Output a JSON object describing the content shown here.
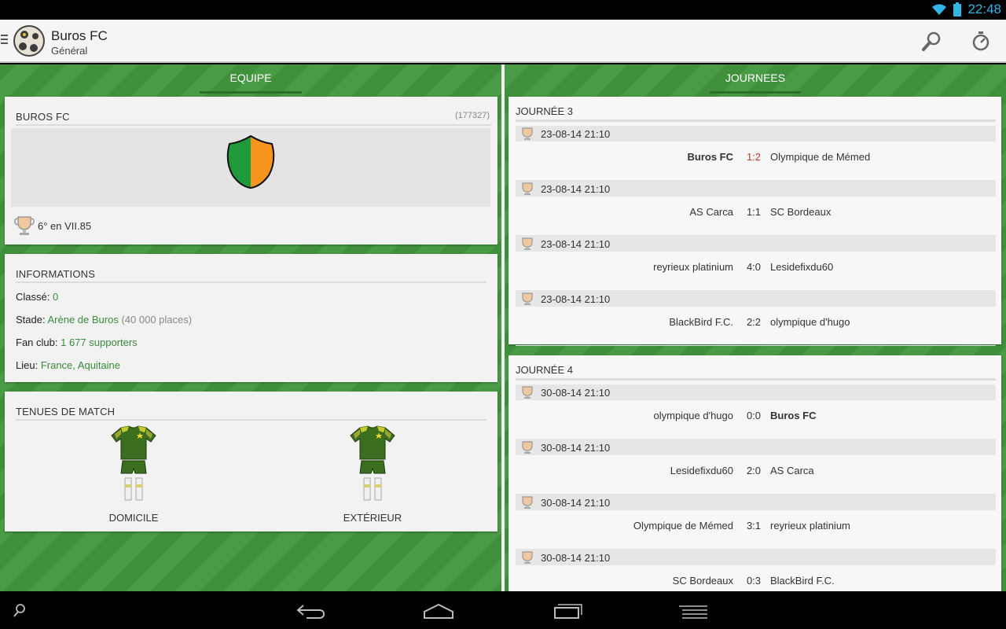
{
  "status_bar": {
    "time": "22:48"
  },
  "app_bar": {
    "title": "Buros FC",
    "subtitle": "Général"
  },
  "left_pane": {
    "header": "EQUIPE",
    "team_card": {
      "name": "BUROS FC",
      "id": "(177327)",
      "rank": "6° en VII.85",
      "crest_colors": [
        "#1f9a3a",
        "#f7941d"
      ]
    },
    "info_card": {
      "title": "INFORMATIONS",
      "rows": [
        {
          "label": "Classé:",
          "value": "0",
          "extra": ""
        },
        {
          "label": "Stade:",
          "value": "Arène de Buros",
          "extra": "(40 000 places)"
        },
        {
          "label": "Fan club:",
          "value": "1 677 supporters",
          "extra": ""
        },
        {
          "label": "Lieu:",
          "value": "France, Aquitaine",
          "extra": ""
        }
      ]
    },
    "kits_card": {
      "title": "TENUES DE MATCH",
      "home_label": "DOMICILE",
      "away_label": "EXTÉRIEUR"
    }
  },
  "right_pane": {
    "header": "JOURNEES",
    "journees": [
      {
        "title": "JOURNÉE 3",
        "matches": [
          {
            "date": "23-08-14 21:10",
            "home": "Buros FC",
            "score": "1:2",
            "away": "Olympique de Mémed"
          },
          {
            "date": "23-08-14 21:10",
            "home": "AS Carca",
            "score": "1:1",
            "away": "SC Bordeaux"
          },
          {
            "date": "23-08-14 21:10",
            "home": "reyrieux platinium",
            "score": "4:0",
            "away": "Lesidefixdu60"
          },
          {
            "date": "23-08-14 21:10",
            "home": "BlackBird F.C.",
            "score": "2:2",
            "away": "olympique d'hugo"
          }
        ]
      },
      {
        "title": "JOURNÉE 4",
        "matches": [
          {
            "date": "30-08-14 21:10",
            "home": "olympique d'hugo",
            "score": "0:0",
            "away": "Buros FC"
          },
          {
            "date": "30-08-14 21:10",
            "home": "Lesidefixdu60",
            "score": "2:0",
            "away": "AS Carca"
          },
          {
            "date": "30-08-14 21:10",
            "home": "Olympique de Mémed",
            "score": "3:1",
            "away": "reyrieux platinium"
          },
          {
            "date": "30-08-14 21:10",
            "home": "SC Bordeaux",
            "score": "0:3",
            "away": "BlackBird F.C."
          }
        ]
      }
    ]
  },
  "icons": {
    "app_bar": [
      "menu-icon",
      "app-logo-icon",
      "search-icon",
      "stopwatch-icon"
    ],
    "status_bar": [
      "wifi-icon",
      "battery-icon"
    ],
    "nav_bar": [
      "search-icon",
      "back-icon",
      "home-icon",
      "recents-icon",
      "menu-icon"
    ],
    "match": "trophy-icon"
  },
  "colors": {
    "pitch_green": "#3f8f3b",
    "accent_blue": "#33b5e5",
    "link_green": "#3a8a3a",
    "loss_red": "#c0392b"
  }
}
